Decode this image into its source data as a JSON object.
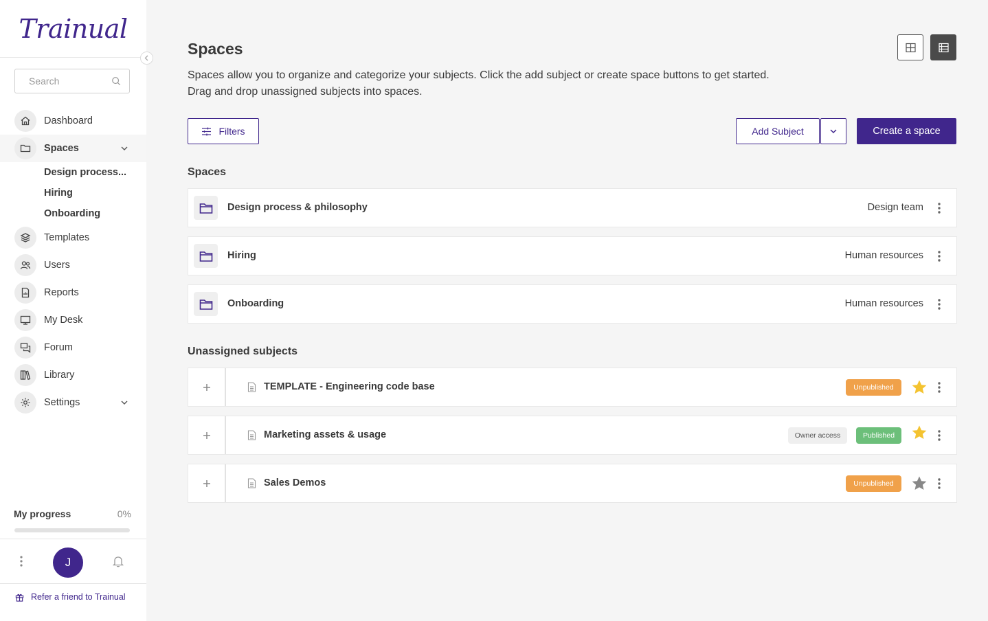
{
  "app": {
    "logo": "Trainual"
  },
  "sidebar": {
    "search": {
      "placeholder": "Search",
      "value": ""
    },
    "nav": [
      {
        "label": "Dashboard",
        "icon": "home-icon"
      },
      {
        "label": "Spaces",
        "icon": "folder-icon",
        "active": true,
        "expanded": true,
        "children": [
          {
            "label": "Design process..."
          },
          {
            "label": "Hiring"
          },
          {
            "label": "Onboarding"
          }
        ]
      },
      {
        "label": "Templates",
        "icon": "layers-icon"
      },
      {
        "label": "Users",
        "icon": "users-icon"
      },
      {
        "label": "Reports",
        "icon": "report-icon"
      },
      {
        "label": "My Desk",
        "icon": "monitor-icon"
      },
      {
        "label": "Forum",
        "icon": "chat-icon"
      },
      {
        "label": "Library",
        "icon": "books-icon"
      },
      {
        "label": "Settings",
        "icon": "gear-icon"
      }
    ],
    "progress": {
      "label": "My progress",
      "value_text": "0%",
      "value": 0
    },
    "avatar_initial": "J",
    "refer_label": "Refer a friend to Trainual"
  },
  "main": {
    "title": "Spaces",
    "description_line1": "Spaces allow you to organize and categorize your subjects. Click the add subject or create space buttons to get started.",
    "description_line2": "Drag and drop unassigned subjects into spaces.",
    "view_mode": "list",
    "filters_label": "Filters",
    "add_subject_label": "Add Subject",
    "create_space_label": "Create a space",
    "spaces_heading": "Spaces",
    "spaces": [
      {
        "name": "Design process & philosophy",
        "team": "Design team"
      },
      {
        "name": "Hiring",
        "team": "Human resources"
      },
      {
        "name": "Onboarding",
        "team": "Human resources"
      }
    ],
    "unassigned_heading": "Unassigned subjects",
    "subjects": [
      {
        "name": "TEMPLATE - Engineering code base",
        "status": "Unpublished",
        "owner_access": "",
        "starred": true
      },
      {
        "name": "Marketing assets & usage",
        "status": "Published",
        "owner_access": "Owner access",
        "starred": true
      },
      {
        "name": "Sales Demos",
        "status": "Unpublished",
        "owner_access": "",
        "starred": false
      }
    ]
  },
  "colors": {
    "brand": "#40268c",
    "unpublished": "#f0a14a",
    "published": "#6cbf7a",
    "star_on": "#f4c330",
    "star_off": "#888888"
  }
}
